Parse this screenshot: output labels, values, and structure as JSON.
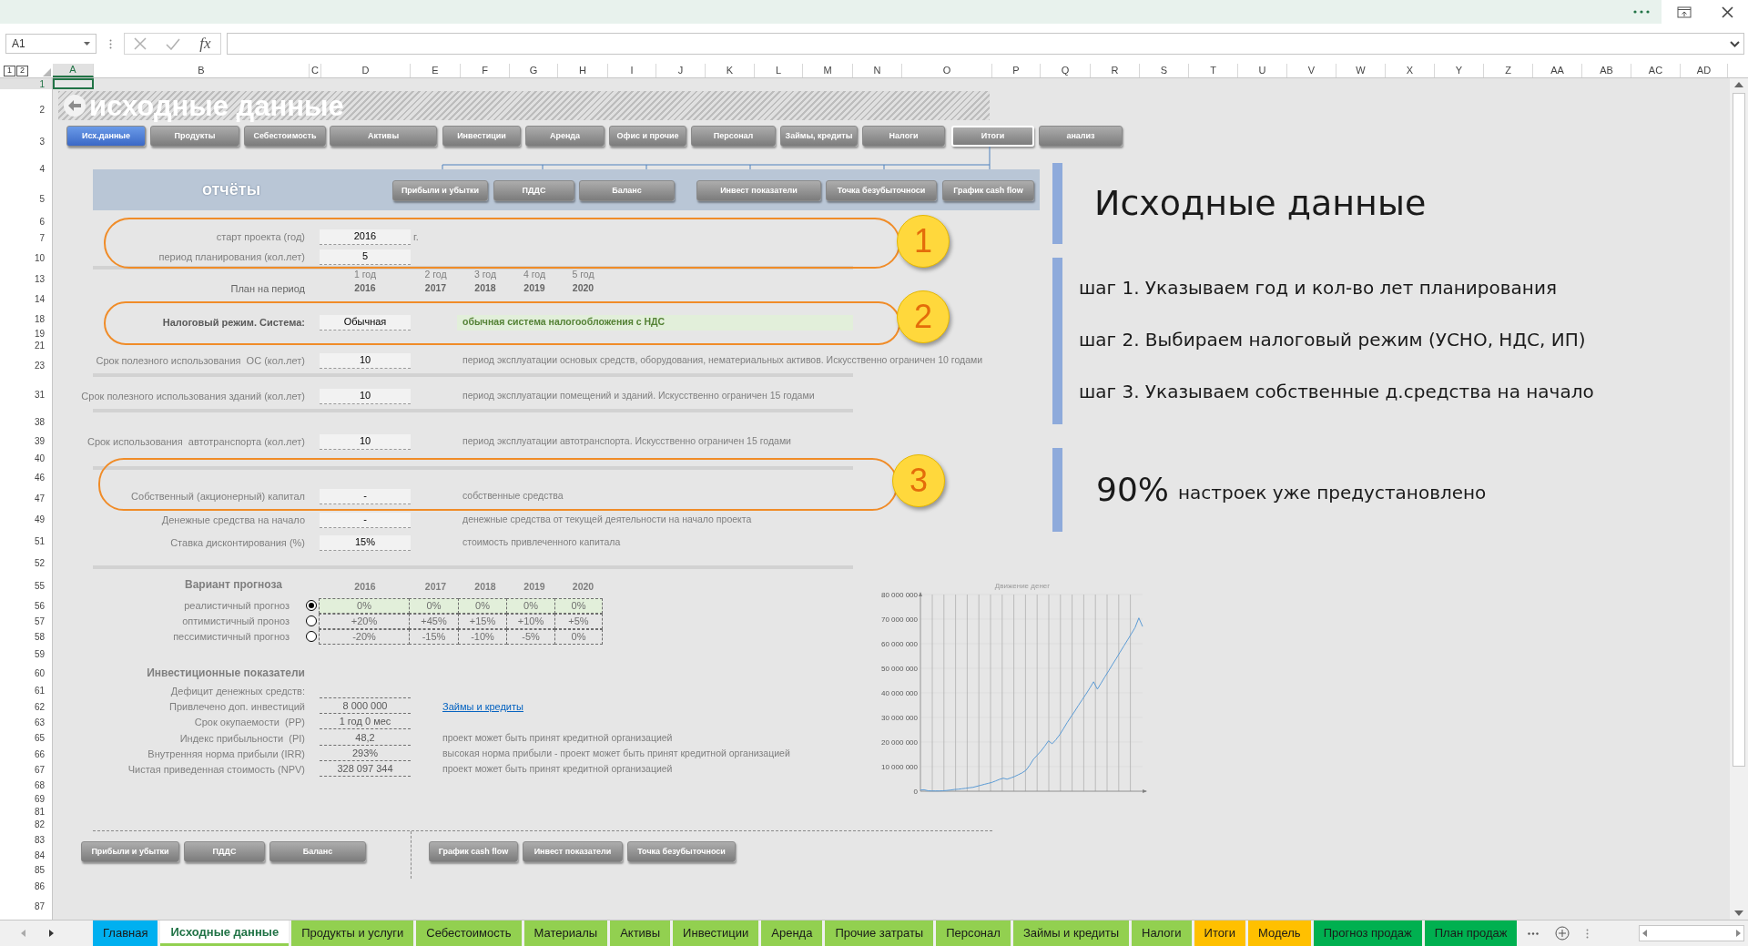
{
  "formula_bar": {
    "name_box": "A1",
    "function_label": "fx"
  },
  "outline_levels": [
    "1",
    "2"
  ],
  "columns": [
    {
      "label": "A",
      "selected": true
    },
    {
      "label": "B",
      "selected": false
    },
    {
      "label": "C",
      "selected": false
    },
    {
      "label": "D",
      "selected": false
    },
    {
      "label": "E",
      "selected": false
    },
    {
      "label": "F",
      "selected": false
    },
    {
      "label": "G",
      "selected": false
    },
    {
      "label": "H",
      "selected": false
    },
    {
      "label": "I",
      "selected": false
    },
    {
      "label": "J",
      "selected": false
    },
    {
      "label": "K",
      "selected": false
    },
    {
      "label": "L",
      "selected": false
    },
    {
      "label": "M",
      "selected": false
    },
    {
      "label": "N",
      "selected": false
    },
    {
      "label": "O",
      "selected": false
    },
    {
      "label": "P",
      "selected": false
    },
    {
      "label": "Q",
      "selected": false
    },
    {
      "label": "R",
      "selected": false
    },
    {
      "label": "S",
      "selected": false
    },
    {
      "label": "T",
      "selected": false
    },
    {
      "label": "U",
      "selected": false
    },
    {
      "label": "V",
      "selected": false
    },
    {
      "label": "W",
      "selected": false
    },
    {
      "label": "X",
      "selected": false
    },
    {
      "label": "Y",
      "selected": false
    },
    {
      "label": "Z",
      "selected": false
    },
    {
      "label": "AA",
      "selected": false
    },
    {
      "label": "AB",
      "selected": false
    },
    {
      "label": "AC",
      "selected": false
    },
    {
      "label": "AD",
      "selected": false
    }
  ],
  "rows": [
    {
      "label": "1",
      "selected": true
    },
    {
      "label": "2",
      "selected": false
    },
    {
      "label": "3",
      "selected": false
    },
    {
      "label": "4",
      "selected": false
    },
    {
      "label": "5",
      "selected": false
    },
    {
      "label": "6",
      "selected": false
    },
    {
      "label": "7",
      "selected": false
    },
    {
      "label": "10",
      "selected": false
    },
    {
      "label": "13",
      "selected": false
    },
    {
      "label": "14",
      "selected": false
    },
    {
      "label": "18",
      "selected": false
    },
    {
      "label": "19",
      "selected": false
    },
    {
      "label": "21",
      "selected": false
    },
    {
      "label": "23",
      "selected": false
    },
    {
      "label": "31",
      "selected": false
    },
    {
      "label": "38",
      "selected": false
    },
    {
      "label": "39",
      "selected": false
    },
    {
      "label": "40",
      "selected": false
    },
    {
      "label": "46",
      "selected": false
    },
    {
      "label": "47",
      "selected": false
    },
    {
      "label": "49",
      "selected": false
    },
    {
      "label": "51",
      "selected": false
    },
    {
      "label": "52",
      "selected": false
    },
    {
      "label": "55",
      "selected": false
    },
    {
      "label": "56",
      "selected": false
    },
    {
      "label": "57",
      "selected": false
    },
    {
      "label": "58",
      "selected": false
    },
    {
      "label": "59",
      "selected": false
    },
    {
      "label": "60",
      "selected": false
    },
    {
      "label": "61",
      "selected": false
    },
    {
      "label": "62",
      "selected": false
    },
    {
      "label": "63",
      "selected": false
    },
    {
      "label": "65",
      "selected": false
    },
    {
      "label": "66",
      "selected": false
    },
    {
      "label": "67",
      "selected": false
    },
    {
      "label": "68",
      "selected": false
    },
    {
      "label": "69",
      "selected": false
    },
    {
      "label": "81",
      "selected": false
    },
    {
      "label": "82",
      "selected": false
    },
    {
      "label": "83",
      "selected": false
    },
    {
      "label": "84",
      "selected": false
    },
    {
      "label": "85",
      "selected": false
    },
    {
      "label": "86",
      "selected": false
    },
    {
      "label": "87",
      "selected": false
    }
  ],
  "title": "исходные данные",
  "nav": [
    {
      "label": "Исх.данные",
      "selected": true,
      "outlined": false
    },
    {
      "label": "Продукты",
      "selected": false,
      "outlined": false
    },
    {
      "label": "Себестоимость",
      "selected": false,
      "outlined": false
    },
    {
      "label": "Активы",
      "selected": false,
      "outlined": false
    },
    {
      "label": "Инвестиции",
      "selected": false,
      "outlined": false
    },
    {
      "label": "Аренда",
      "selected": false,
      "outlined": false
    },
    {
      "label": "Офис и прочие",
      "selected": false,
      "outlined": false
    },
    {
      "label": "Персонал",
      "selected": false,
      "outlined": false
    },
    {
      "label": "Займы, кредиты",
      "selected": false,
      "outlined": false
    },
    {
      "label": "Налоги",
      "selected": false,
      "outlined": false
    },
    {
      "label": "Итоги",
      "selected": false,
      "outlined": true
    },
    {
      "label": "анализ",
      "selected": false,
      "outlined": false
    }
  ],
  "reports": {
    "title": "отчёты",
    "buttons": [
      "Прибыли и убытки",
      "ПДДС",
      "Баланс",
      "Инвест показатели",
      "Точка безубыточноси",
      "График cash flow"
    ]
  },
  "setup": {
    "start": {
      "label": "старт проекта (год)",
      "value": "2016",
      "unit": "г."
    },
    "period": {
      "label": "период планирования (кол.лет)",
      "value": "5"
    },
    "year_numbers": [
      "1 год",
      "2 год",
      "3 год",
      "4 год",
      "5 год"
    ],
    "plan": {
      "label": "План на период",
      "years": [
        "2016",
        "2017",
        "2018",
        "2019",
        "2020"
      ]
    },
    "tax": {
      "label": "Налоговый режим. Система:",
      "value": "Обычная",
      "note": "обычная система налогообложения с НДС"
    },
    "terms": [
      {
        "label": "Срок полезного использования  ОС (кол.лет)",
        "value": "10",
        "note": "период эксплуатации основых средств, оборудования, нематериальных активов. Искусственно ограничен 10 годами"
      },
      {
        "label": "Срок полезного использования зданий (кол.лет)",
        "value": "10",
        "note": "период эксплуатации помещений и зданий. Искусственно ограничен 15 годами"
      },
      {
        "label": "Срок использования  автотранспорта (кол.лет)",
        "value": "10",
        "note": "период эксплуатации автотранспорта. Искусственно ограничен 15 годами"
      }
    ],
    "finance": [
      {
        "label": "Собственный (акционерный) капитал",
        "value": "-",
        "note": "собственные средства"
      },
      {
        "label": "Денежные средства на начало",
        "value": "-",
        "note": "денежные средства от текущей деятельности на начало проекта"
      },
      {
        "label": "Ставка дисконтирования (%)",
        "value": "15%",
        "note": "стоимость привлеченного капитала"
      }
    ]
  },
  "forecast": {
    "title": "Вариант прогноза",
    "years": [
      "2016",
      "2017",
      "2018",
      "2019",
      "2020"
    ],
    "rows": [
      {
        "label": "реалистичный прогноз",
        "selected": true,
        "values": [
          "0%",
          "0%",
          "0%",
          "0%",
          "0%"
        ]
      },
      {
        "label": "оптимистичный проноз",
        "selected": false,
        "values": [
          "+20%",
          "+45%",
          "+15%",
          "+10%",
          "+5%"
        ]
      },
      {
        "label": "пессимистичный прогноз",
        "selected": false,
        "values": [
          "-20%",
          "-15%",
          "-10%",
          "-5%",
          "0%"
        ]
      }
    ]
  },
  "investment": {
    "title": "Инвестиционные показатели",
    "rows": [
      {
        "label": "Дефицит денежных средств:"
      },
      {
        "label": "Привлечено доп. инвестиций",
        "value": "8 000 000",
        "link": "Займы и кредиты"
      },
      {
        "label": "Срок окупаемости  (PP)",
        "value": "1 год 0 мес"
      },
      {
        "label": "Индекс прибыльности  (PI)",
        "value": "48,2",
        "note": "проект может быть принят кредитной организацией"
      },
      {
        "label": "Внутренняя норма прибыли (IRR)",
        "value": "293%",
        "note": "высокая норма прибыли - проект может быть принят кредитной организацией"
      },
      {
        "label": "Чистая приведенная стоимость (NPV)",
        "value": "328 097 344",
        "note": "проект может быть принят кредитной организацией"
      }
    ]
  },
  "bottom_buttons": {
    "left": [
      "Прибыли и убытки",
      "ПДДС",
      "Баланс"
    ],
    "right": [
      "График cash flow",
      "Инвест показатели",
      "Точка безубыточноси"
    ]
  },
  "badges": [
    "1",
    "2",
    "3"
  ],
  "guide": {
    "title": "Исходные данные",
    "steps": [
      "шаг 1. Указываем год и кол-во лет планирования",
      "шаг 2. Выбираем налоговый режим (УСНО, НДС, ИП)",
      "шаг 3. Указываем собственные д.средства на начало"
    ],
    "percent": "90%",
    "percent_note": "настроек уже предустановлено"
  },
  "chart": {
    "chart_data": {
      "type": "line",
      "title": "Движение денег",
      "grid": true,
      "ylim": [
        0,
        80000000
      ],
      "yticks": [
        {
          "value": 0,
          "label": "0"
        },
        {
          "value": 10000000,
          "label": "10 000 000"
        },
        {
          "value": 20000000,
          "label": "20 000 000"
        },
        {
          "value": 30000000,
          "label": "30 000 000"
        },
        {
          "value": 40000000,
          "label": "40 000 000"
        },
        {
          "value": 50000000,
          "label": "50 000 000"
        },
        {
          "value": 60000000,
          "label": "60 000 000"
        },
        {
          "value": 70000000,
          "label": "70 000 000"
        },
        {
          "value": 80000000,
          "label": "80 000 000"
        }
      ],
      "series": [
        {
          "color": "#5b9bd5",
          "values": [
            500000,
            600000,
            200000,
            100000,
            100000,
            100000,
            200000,
            300000,
            500000,
            700000,
            800000,
            1000000,
            1200000,
            1400000,
            1600000,
            2000000,
            2400000,
            2800000,
            3200000,
            3600000,
            4200000,
            4800000,
            5300000,
            4900000,
            5400000,
            6000000,
            6700000,
            7500000,
            8500000,
            10500000,
            13000000,
            14600000,
            16300000,
            18300000,
            20500000,
            19300000,
            21000000,
            23000000,
            25500000,
            28000000,
            30300000,
            32600000,
            35000000,
            37300000,
            39600000,
            42000000,
            44500000,
            41500000,
            44000000,
            46500000,
            49000000,
            51500000,
            54000000,
            56500000,
            59000000,
            61500000,
            64000000,
            66500000,
            70500000,
            67000000
          ]
        }
      ]
    }
  },
  "sheet_tabs": [
    {
      "label": "Главная",
      "selected": false,
      "color": "#00b0f0"
    },
    {
      "label": "Исходные данные",
      "selected": true,
      "color": "#92d050"
    },
    {
      "label": "Продукты и услуги",
      "selected": false,
      "color": "#92d050"
    },
    {
      "label": "Себестоимость",
      "selected": false,
      "color": "#92d050"
    },
    {
      "label": "Материалы",
      "selected": false,
      "color": "#92d050"
    },
    {
      "label": "Активы",
      "selected": false,
      "color": "#92d050"
    },
    {
      "label": "Инвестиции",
      "selected": false,
      "color": "#92d050"
    },
    {
      "label": "Аренда",
      "selected": false,
      "color": "#92d050"
    },
    {
      "label": "Прочие затраты",
      "selected": false,
      "color": "#92d050"
    },
    {
      "label": "Персонал",
      "selected": false,
      "color": "#92d050"
    },
    {
      "label": "Займы и кредиты",
      "selected": false,
      "color": "#92d050"
    },
    {
      "label": "Налоги",
      "selected": false,
      "color": "#92d050"
    },
    {
      "label": "Итоги",
      "selected": false,
      "color": "#ffc000"
    },
    {
      "label": "Модель",
      "selected": false,
      "color": "#ffc000"
    },
    {
      "label": "Прогноз продаж",
      "selected": false,
      "color": "#00b050"
    },
    {
      "label": "План продаж",
      "selected": false,
      "color": "#00b050"
    }
  ]
}
